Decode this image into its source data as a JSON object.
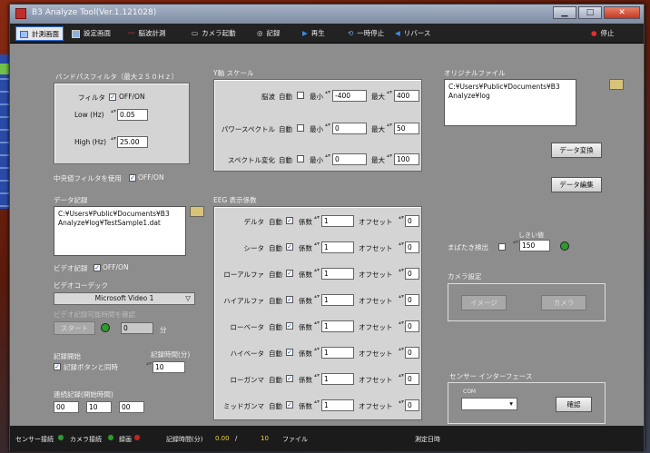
{
  "window": {
    "title": "B3 Analyze Tool(Ver.1.121028)",
    "min": "▁",
    "max": "□",
    "close": "✕"
  },
  "toolbar": {
    "measure": "計測画面",
    "settings": "設定画面",
    "eeg_measure": "脳波計測",
    "camera_start": "カメラ起動",
    "record": "記録",
    "play": "再生",
    "pause": "一時停止",
    "reverse": "リバース",
    "stop": "停止"
  },
  "bandpass": {
    "heading": "バンドパスフィルタ（最大２５０Ｈｚ）",
    "filter_label": "フィルタ",
    "filter_toggle": "OFF/ON",
    "low_label": "Low (Hz)",
    "low_value": "0.05",
    "high_label": "High (Hz)",
    "high_value": "25.00"
  },
  "center_filter": {
    "label": "中央値フィルタを使用",
    "toggle": "OFF/ON"
  },
  "data_record": {
    "heading": "データ記録",
    "path_line1": "C:¥Users¥Public¥Documents¥B3",
    "path_line2": "Analyze¥log¥TestSample1.dat"
  },
  "video_record": {
    "label": "ビデオ記録",
    "toggle": "OFF/ON"
  },
  "video_codec": {
    "heading": "ビデオコーデック",
    "selected": "Microsoft Video 1"
  },
  "video_time": {
    "heading": "ビデオ記録可能時間を確認",
    "start": "スタート",
    "value": "0",
    "unit": "分"
  },
  "record_start": {
    "heading": "記録開始",
    "sync_label": "記録ボタンと同時",
    "duration_label": "記録時間(分)",
    "duration_value": "10"
  },
  "continuous": {
    "heading": "連続記録(開始時間)",
    "h": "00",
    "m": "10",
    "s": "00"
  },
  "yscale": {
    "heading": "Y軸 スケール",
    "rows": [
      {
        "name": "脳波",
        "auto": "自動",
        "min_label": "最小",
        "min": "-400",
        "max_label": "最大",
        "max": "400"
      },
      {
        "name": "パワースペクトル",
        "auto": "自動",
        "min_label": "最小",
        "min": "0",
        "max_label": "最大",
        "max": "50"
      },
      {
        "name": "スペクトル変化",
        "auto": "自動",
        "min_label": "最小",
        "min": "0",
        "max_label": "最大",
        "max": "100"
      }
    ]
  },
  "eeg": {
    "heading": "EEG 表示係数",
    "rows": [
      {
        "name": "デルタ",
        "auto": "自動",
        "coef_label": "係数",
        "coef": "1",
        "offset_label": "オフセット",
        "offset": "0"
      },
      {
        "name": "シータ",
        "auto": "自動",
        "coef_label": "係数",
        "coef": "1",
        "offset_label": "オフセット",
        "offset": "0"
      },
      {
        "name": "ローアルファ",
        "auto": "自動",
        "coef_label": "係数",
        "coef": "1",
        "offset_label": "オフセット",
        "offset": "0"
      },
      {
        "name": "ハイアルファ",
        "auto": "自動",
        "coef_label": "係数",
        "coef": "1",
        "offset_label": "オフセット",
        "offset": "0"
      },
      {
        "name": "ローベータ",
        "auto": "自動",
        "coef_label": "係数",
        "coef": "1",
        "offset_label": "オフセット",
        "offset": "0"
      },
      {
        "name": "ハイベータ",
        "auto": "自動",
        "coef_label": "係数",
        "coef": "1",
        "offset_label": "オフセット",
        "offset": "0"
      },
      {
        "name": "ローガンマ",
        "auto": "自動",
        "coef_label": "係数",
        "coef": "1",
        "offset_label": "オフセット",
        "offset": "0"
      },
      {
        "name": "ミッドガンマ",
        "auto": "自動",
        "coef_label": "係数",
        "coef": "1",
        "offset_label": "オフセット",
        "offset": "0"
      }
    ]
  },
  "original_file": {
    "heading": "オリジナルファイル",
    "path_line1": "C:¥Users¥Public¥Documents¥B3",
    "path_line2": "Analyze¥log",
    "convert": "データ変換",
    "edit": "データ編集"
  },
  "blink": {
    "label": "まばたき検出",
    "threshold_label": "しきい値",
    "threshold_value": "150"
  },
  "camera": {
    "heading": "カメラ設定",
    "image_btn": "イメージ",
    "camera_btn": "カメラ"
  },
  "sensor": {
    "heading": "センサー インターフェース",
    "com_label": "COM",
    "com_value": "",
    "confirm": "確認"
  },
  "status": {
    "sensor": "センサー接続",
    "camera": "カメラ接続",
    "recording": "録画",
    "rec_time_label": "記録時間(分)",
    "rec_time_value": "0.00",
    "slash": "/",
    "rec_total": "10",
    "file_label": "ファイル",
    "datetime_label": "測定日時"
  },
  "colors": {
    "accent": "#2a6bd0",
    "led_green": "#2e9a2e",
    "led_red": "#c82020"
  }
}
